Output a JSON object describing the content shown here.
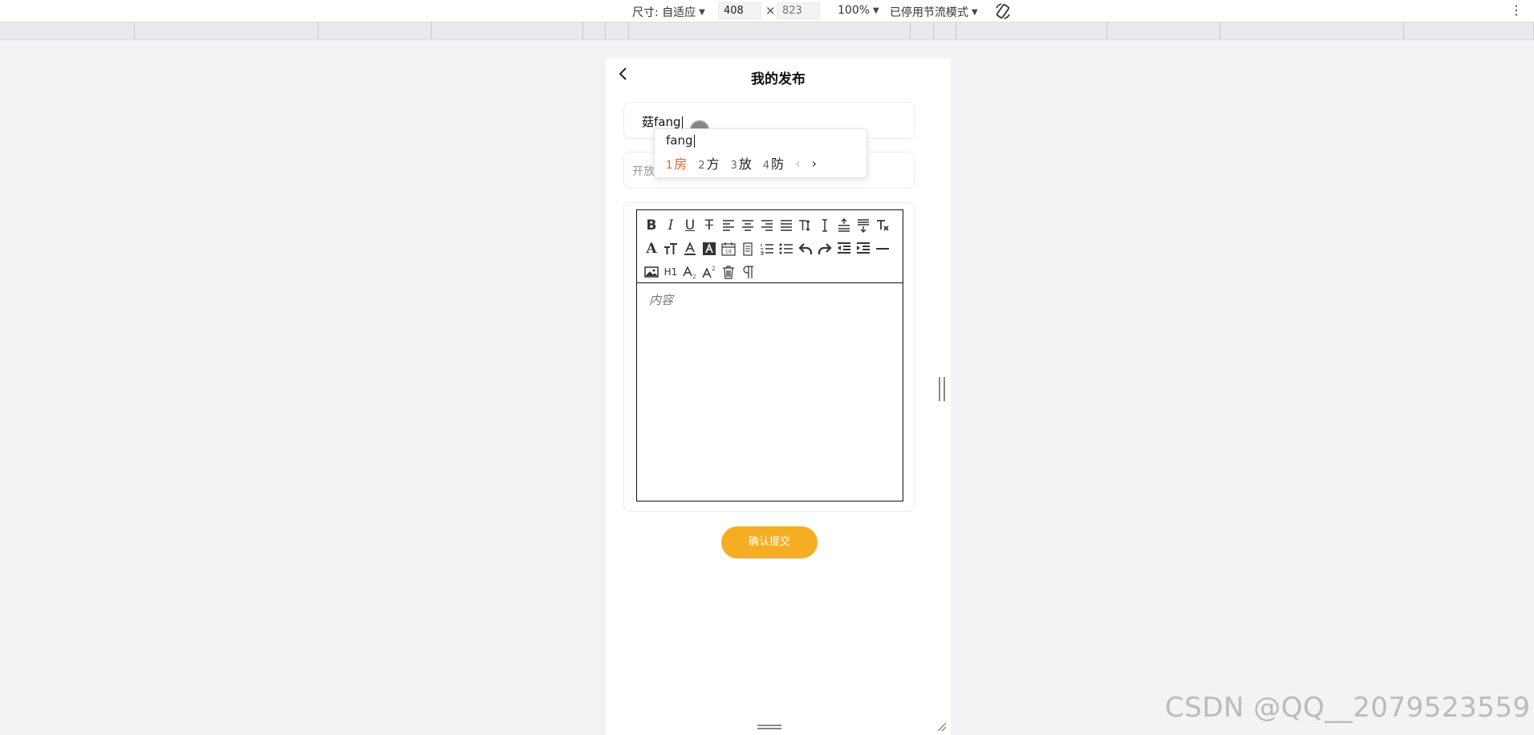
{
  "devtools": {
    "size_label": "尺寸: 自适应",
    "width_value": "408",
    "times": "×",
    "height_placeholder": "823",
    "zoom": "100%",
    "throttle": "已停用节流模式",
    "rotate_icon": "rotate-icon",
    "more_icon": "kebab-menu-icon"
  },
  "page": {
    "title": "我的发布",
    "title_input_value": "菇fang",
    "type_placeholder": "开放",
    "editor_placeholder": "内容",
    "submit_label": "确认提交",
    "accent_color": "#f5ae23"
  },
  "ime": {
    "pinyin": "fang",
    "candidates": [
      {
        "num": "1",
        "text": "房"
      },
      {
        "num": "2",
        "text": "方"
      },
      {
        "num": "3",
        "text": "放"
      },
      {
        "num": "4",
        "text": "防"
      }
    ],
    "prev": "‹",
    "next": "›"
  },
  "editor_toolbar": {
    "bold": "B",
    "italic": "I",
    "underline": "U",
    "strike": "T",
    "h1": "H1"
  },
  "watermark": "CSDN @QQ__2079523559"
}
